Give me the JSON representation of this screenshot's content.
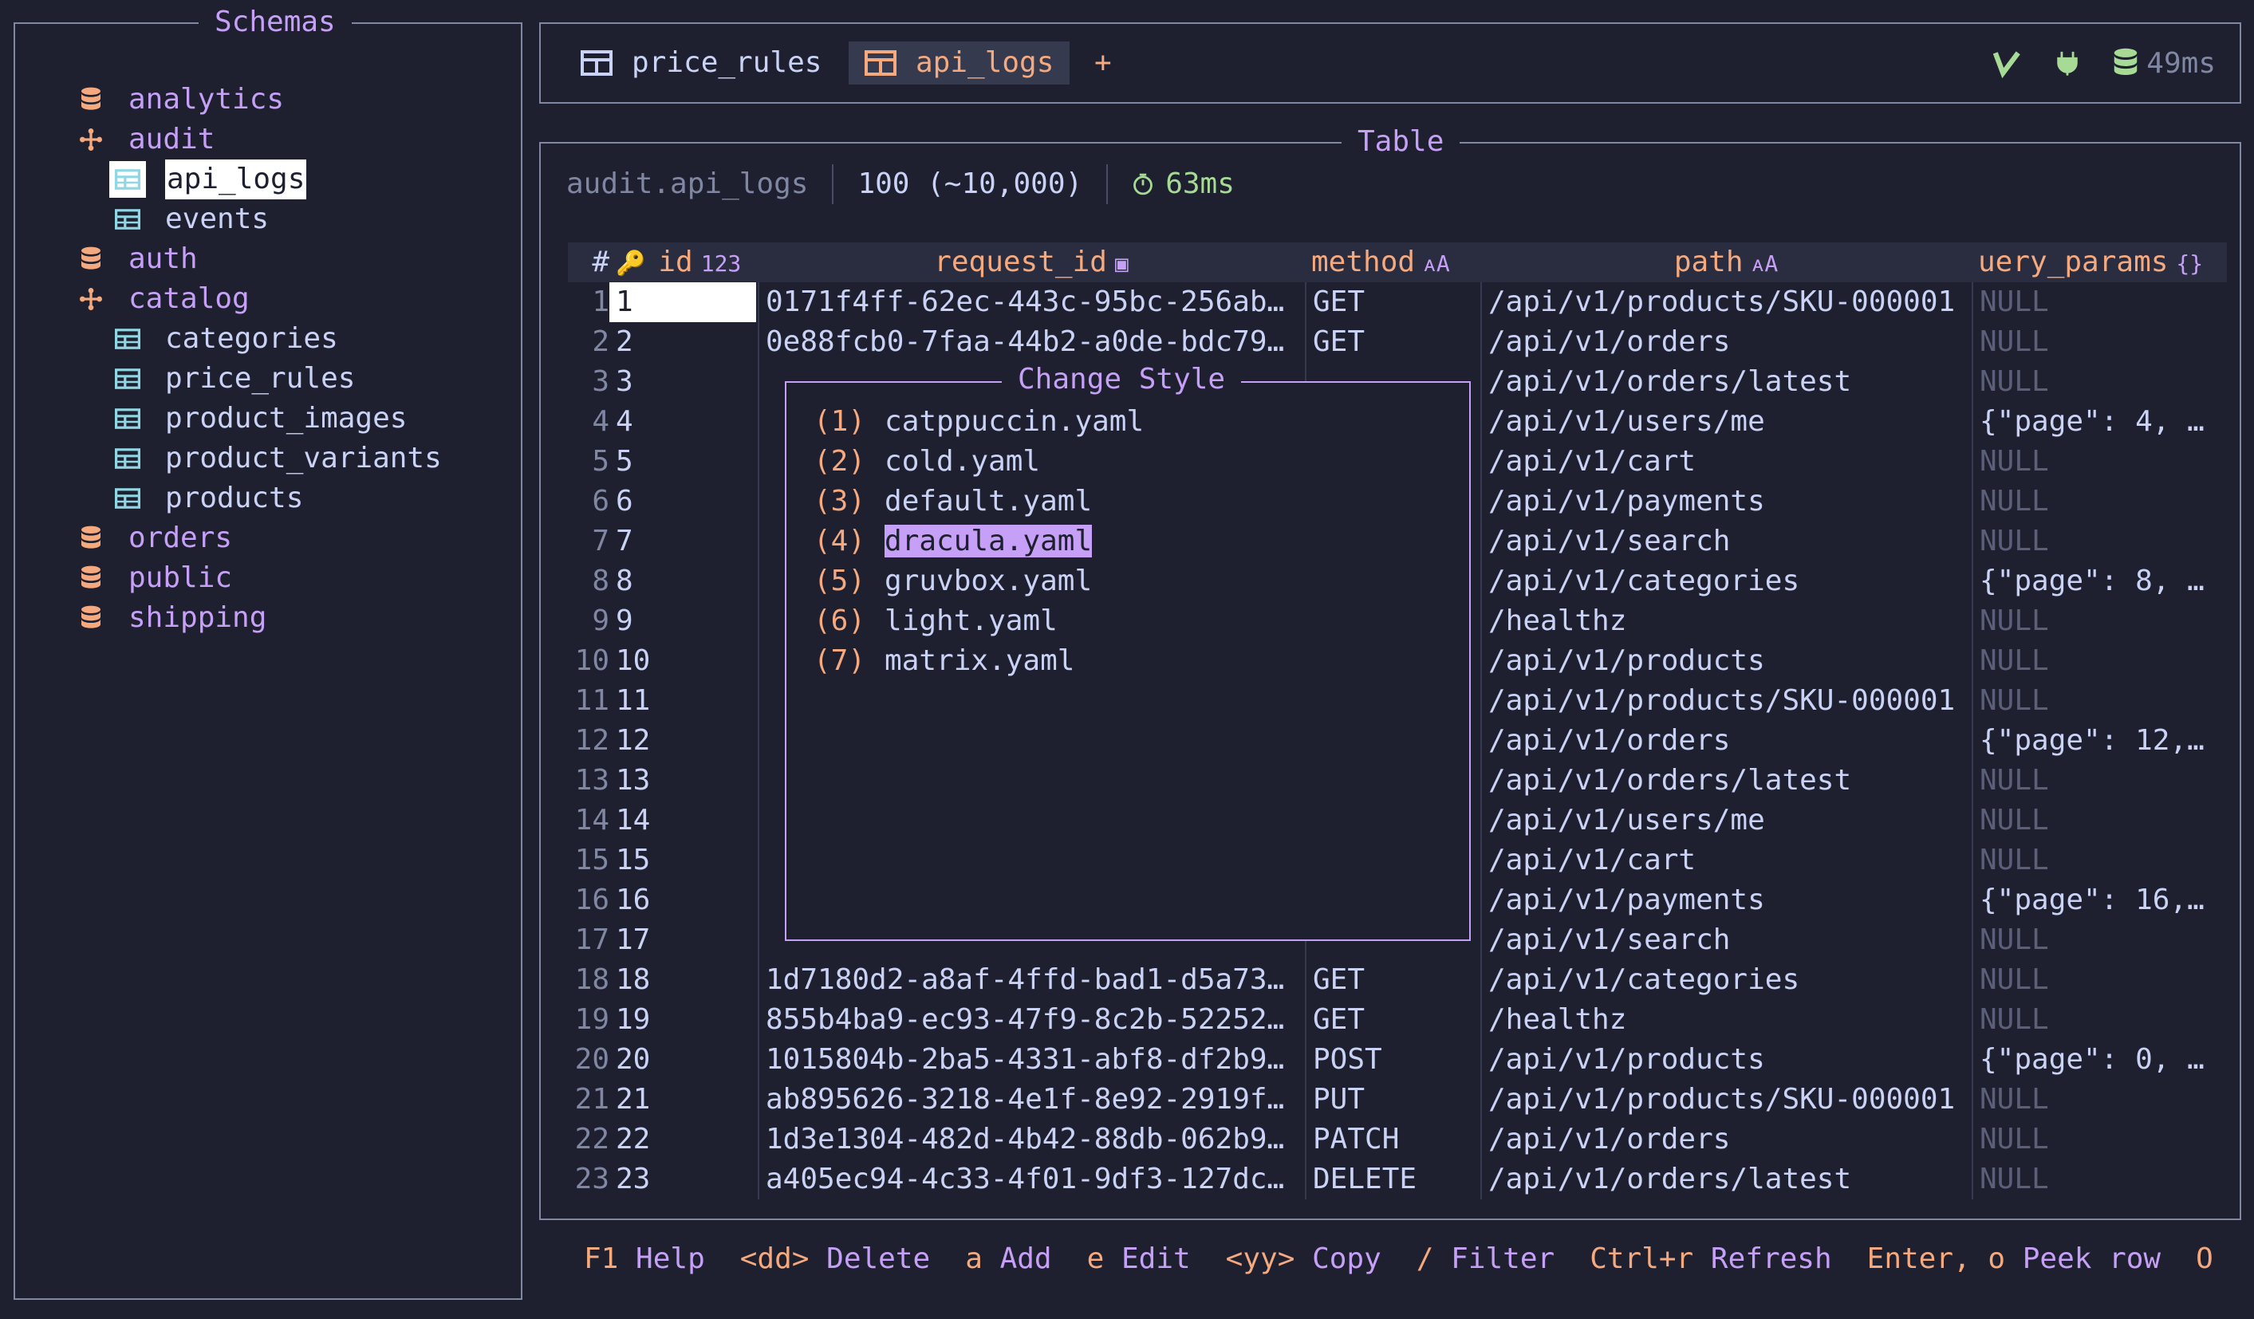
{
  "sidebar": {
    "title": "Schemas",
    "tree": [
      {
        "kind": "schema",
        "label": "analytics",
        "icon": "database-icon"
      },
      {
        "kind": "schema",
        "label": "audit",
        "icon": "schema-branch-icon"
      },
      {
        "kind": "table",
        "label": "api_logs",
        "icon": "table-icon",
        "selected": true
      },
      {
        "kind": "table",
        "label": "events",
        "icon": "table-icon"
      },
      {
        "kind": "schema",
        "label": "auth",
        "icon": "database-icon"
      },
      {
        "kind": "schema",
        "label": "catalog",
        "icon": "schema-branch-icon"
      },
      {
        "kind": "table",
        "label": "categories",
        "icon": "table-icon"
      },
      {
        "kind": "table",
        "label": "price_rules",
        "icon": "table-icon"
      },
      {
        "kind": "table",
        "label": "product_images",
        "icon": "table-icon"
      },
      {
        "kind": "table",
        "label": "product_variants",
        "icon": "table-icon"
      },
      {
        "kind": "table",
        "label": "products",
        "icon": "table-icon"
      },
      {
        "kind": "schema",
        "label": "orders",
        "icon": "database-icon"
      },
      {
        "kind": "schema",
        "label": "public",
        "icon": "database-icon"
      },
      {
        "kind": "schema",
        "label": "shipping",
        "icon": "database-icon"
      }
    ]
  },
  "tabs": {
    "items": [
      {
        "label": "price_rules",
        "active": false
      },
      {
        "label": "api_logs",
        "active": true
      }
    ],
    "add_label": "+",
    "latency": "49ms"
  },
  "table_panel": {
    "title": "Table",
    "table_name": "audit.api_logs",
    "row_count": "100 (~10,000)",
    "query_time": "63ms",
    "columns": [
      {
        "key": "rownum",
        "label": "#"
      },
      {
        "key": "id",
        "label": "id",
        "icon": "123"
      },
      {
        "key": "request_id",
        "label": "request_id",
        "icon": "▣"
      },
      {
        "key": "method",
        "label": "method",
        "icon": "ᴀA"
      },
      {
        "key": "path",
        "label": "path",
        "icon": "ᴀA"
      },
      {
        "key": "query_params",
        "label": "uery_params",
        "icon": "{}"
      }
    ],
    "rows": [
      {
        "n": "1",
        "id": "1",
        "request_id": "0171f4ff-62ec-443c-95bc-256ab…",
        "method": "GET",
        "path": "/api/v1/products/SKU-000001",
        "query_params": "NULL"
      },
      {
        "n": "2",
        "id": "2",
        "request_id": "0e88fcb0-7faa-44b2-a0de-bdc79…",
        "method": "GET",
        "path": "/api/v1/orders",
        "query_params": "NULL"
      },
      {
        "n": "3",
        "id": "3",
        "request_id": "",
        "method": "",
        "path": "/api/v1/orders/latest",
        "query_params": "NULL"
      },
      {
        "n": "4",
        "id": "4",
        "request_id": "",
        "method": "",
        "path": "/api/v1/users/me",
        "query_params": "{\"page\": 4, …"
      },
      {
        "n": "5",
        "id": "5",
        "request_id": "",
        "method": "",
        "path": "/api/v1/cart",
        "query_params": "NULL"
      },
      {
        "n": "6",
        "id": "6",
        "request_id": "",
        "method": "",
        "path": "/api/v1/payments",
        "query_params": "NULL"
      },
      {
        "n": "7",
        "id": "7",
        "request_id": "",
        "method": "",
        "path": "/api/v1/search",
        "query_params": "NULL"
      },
      {
        "n": "8",
        "id": "8",
        "request_id": "",
        "method": "",
        "path": "/api/v1/categories",
        "query_params": "{\"page\": 8, …"
      },
      {
        "n": "9",
        "id": "9",
        "request_id": "",
        "method": "",
        "path": "/healthz",
        "query_params": "NULL"
      },
      {
        "n": "10",
        "id": "10",
        "request_id": "",
        "method": "",
        "path": "/api/v1/products",
        "query_params": "NULL"
      },
      {
        "n": "11",
        "id": "11",
        "request_id": "",
        "method": "",
        "path": "/api/v1/products/SKU-000001",
        "query_params": "NULL"
      },
      {
        "n": "12",
        "id": "12",
        "request_id": "",
        "method": "",
        "path": "/api/v1/orders",
        "query_params": "{\"page\": 12,…"
      },
      {
        "n": "13",
        "id": "13",
        "request_id": "",
        "method": "",
        "path": "/api/v1/orders/latest",
        "query_params": "NULL"
      },
      {
        "n": "14",
        "id": "14",
        "request_id": "",
        "method": "",
        "path": "/api/v1/users/me",
        "query_params": "NULL"
      },
      {
        "n": "15",
        "id": "15",
        "request_id": "",
        "method": "",
        "path": "/api/v1/cart",
        "query_params": "NULL"
      },
      {
        "n": "16",
        "id": "16",
        "request_id": "",
        "method": "",
        "path": "/api/v1/payments",
        "query_params": "{\"page\": 16,…"
      },
      {
        "n": "17",
        "id": "17",
        "request_id": "",
        "method": "",
        "path": "/api/v1/search",
        "query_params": "NULL"
      },
      {
        "n": "18",
        "id": "18",
        "request_id": "1d7180d2-a8af-4ffd-bad1-d5a73…",
        "method": "GET",
        "path": "/api/v1/categories",
        "query_params": "NULL"
      },
      {
        "n": "19",
        "id": "19",
        "request_id": "855b4ba9-ec93-47f9-8c2b-52252…",
        "method": "GET",
        "path": "/healthz",
        "query_params": "NULL"
      },
      {
        "n": "20",
        "id": "20",
        "request_id": "1015804b-2ba5-4331-abf8-df2b9…",
        "method": "POST",
        "path": "/api/v1/products",
        "query_params": "{\"page\": 0, …"
      },
      {
        "n": "21",
        "id": "21",
        "request_id": "ab895626-3218-4e1f-8e92-2919f…",
        "method": "PUT",
        "path": "/api/v1/products/SKU-000001",
        "query_params": "NULL"
      },
      {
        "n": "22",
        "id": "22",
        "request_id": "1d3e1304-482d-4b42-88db-062b9…",
        "method": "PATCH",
        "path": "/api/v1/orders",
        "query_params": "NULL"
      },
      {
        "n": "23",
        "id": "23",
        "request_id": "a405ec94-4c33-4f01-9df3-127dc…",
        "method": "DELETE",
        "path": "/api/v1/orders/latest",
        "query_params": "NULL"
      }
    ]
  },
  "modal": {
    "title": "Change Style",
    "options": [
      {
        "num": "(1)",
        "name": "catppuccin.yaml"
      },
      {
        "num": "(2)",
        "name": "cold.yaml"
      },
      {
        "num": "(3)",
        "name": "default.yaml"
      },
      {
        "num": "(4)",
        "name": "dracula.yaml",
        "highlight": true
      },
      {
        "num": "(5)",
        "name": "gruvbox.yaml"
      },
      {
        "num": "(6)",
        "name": "light.yaml"
      },
      {
        "num": "(7)",
        "name": "matrix.yaml"
      }
    ]
  },
  "footer": [
    {
      "key": "F1",
      "label": "Help"
    },
    {
      "key": "<dd>",
      "label": "Delete"
    },
    {
      "key": "a",
      "label": "Add"
    },
    {
      "key": "e",
      "label": "Edit"
    },
    {
      "key": "<yy>",
      "label": "Copy"
    },
    {
      "key": "/",
      "label": "Filter"
    },
    {
      "key": "Ctrl+r",
      "label": "Refresh"
    },
    {
      "key": "Enter, o",
      "label": "Peek row"
    },
    {
      "key": "O",
      "label": ""
    }
  ],
  "colors": {
    "background": "#1e2030",
    "accent_purple": "#c6a0f6",
    "accent_orange": "#f5a97f",
    "accent_green": "#a6da95",
    "table_icon": "#91d7e3",
    "null_text": "#5b6078"
  }
}
